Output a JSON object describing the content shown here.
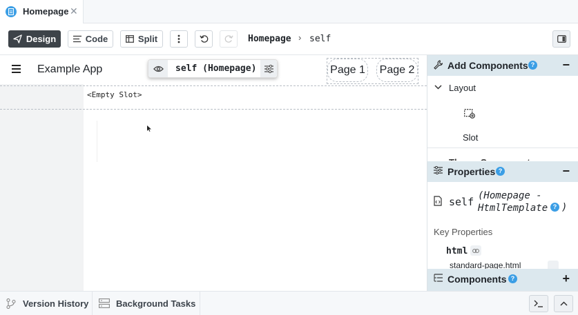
{
  "tab": {
    "label": "Homepage",
    "close": "✕"
  },
  "toolbar": {
    "design": "Design",
    "code": "Code",
    "split": "Split",
    "breadcrumb": {
      "form": "Homepage",
      "separator": "›",
      "component": "self"
    }
  },
  "canvas": {
    "app_title": "Example App",
    "selection_label": "self (Homepage)",
    "nav_links": [
      "Page 1",
      "Page 2"
    ],
    "empty_slot": "<Empty Slot>"
  },
  "add_components": {
    "title": "Add Components",
    "help": "?",
    "collapse": "−",
    "layout": {
      "label": "Layout",
      "slot_label": "Slot"
    },
    "theme_partial": "Theme Components"
  },
  "properties": {
    "title": "Properties",
    "help": "?",
    "collapse": "−",
    "component_name": "self",
    "component_type": "(Homepage - HtmlTemplate",
    "component_type_close": ")",
    "key_properties": "Key Properties",
    "html_label": "html",
    "html_value": "standard-page.html"
  },
  "components": {
    "title": "Components",
    "help": "?",
    "add": "+"
  },
  "bottom": {
    "version_history": "Version History",
    "background_tasks": "Background Tasks"
  },
  "colors": {
    "accent": "#3b9ee5",
    "primary_button": "#3d4349",
    "panel_header": "#dce8ee"
  }
}
